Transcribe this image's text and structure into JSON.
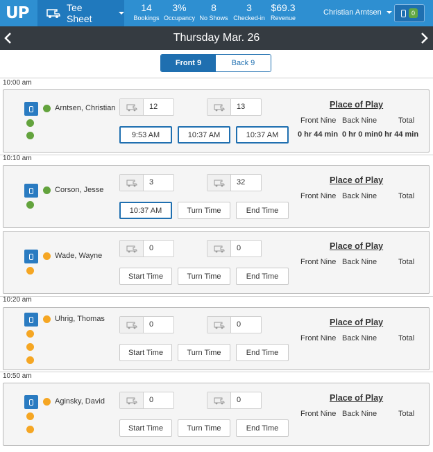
{
  "header": {
    "logo": "UP",
    "app_title": "Tee Sheet",
    "stats": [
      {
        "value": "14",
        "label": "Bookings"
      },
      {
        "value": "3%",
        "label": "Occupancy"
      },
      {
        "value": "8",
        "label": "No Shows"
      },
      {
        "value": "3",
        "label": "Checked-in"
      },
      {
        "value": "$69.3",
        "label": "Revenue"
      }
    ],
    "user_name": "Christian Arntsen",
    "message_count": "0",
    "icons": {
      "cart": "golf-cart-icon",
      "caret": "caret-down-icon",
      "phone": "mobile-phone-icon"
    }
  },
  "datebar": {
    "date": "Thursday Mar. 26",
    "prev_icon": "chevron-left-icon",
    "next_icon": "chevron-right-icon"
  },
  "nine_toggle": {
    "front": "Front 9",
    "back": "Back 9",
    "selected": "front"
  },
  "place_of_play": {
    "title": "Place of Play",
    "front_label": "Front Nine",
    "back_label": "Back Nine",
    "total_label": "Total"
  },
  "time_slots": [
    {
      "time": "10:00 am"
    },
    {
      "time": "10:10 am"
    },
    {
      "time": "10:20 am"
    },
    {
      "time": "10:50 am"
    }
  ],
  "bookings": [
    {
      "player": "Arntsen, Christian",
      "status_color": "#63a33d",
      "extra_dots": 2,
      "cart1": "12",
      "cart2": "13",
      "start": "9:53 AM",
      "turn": "10:37 AM",
      "end": "10:37 AM",
      "start_set": true,
      "turn_set": true,
      "end_set": true,
      "front_duration": "0 hr 44 min",
      "back_duration": "0 hr 0 min",
      "total_duration": "0 hr 44 min"
    },
    {
      "player": "Corson, Jesse",
      "status_color": "#63a33d",
      "extra_dots": 1,
      "cart1": "3",
      "cart2": "32",
      "start": "10:37 AM",
      "turn": "Turn Time",
      "end": "End Time",
      "start_set": true,
      "turn_set": false,
      "end_set": false
    },
    {
      "player": "Wade, Wayne",
      "status_color": "#f5a623",
      "extra_dots": 1,
      "cart1": "0",
      "cart2": "0",
      "start": "Start Time",
      "turn": "Turn Time",
      "end": "End Time",
      "start_set": false,
      "turn_set": false,
      "end_set": false
    },
    {
      "player": "Uhrig, Thomas",
      "status_color": "#f5a623",
      "extra_dots": 3,
      "cart1": "0",
      "cart2": "0",
      "start": "Start Time",
      "turn": "Turn Time",
      "end": "End Time",
      "start_set": false,
      "turn_set": false,
      "end_set": false
    },
    {
      "player": "Aginsky, David",
      "status_color": "#f5a623",
      "extra_dots": 2,
      "cart1": "0",
      "cart2": "0",
      "start": "Start Time",
      "turn": "Turn Time",
      "end": "End Time",
      "start_set": false,
      "turn_set": false,
      "end_set": false
    }
  ],
  "colors": {
    "header_blue": "#2e8fd1",
    "header_dark_blue": "#2079bd",
    "date_bar": "#353b41",
    "accent": "#1f6fb0",
    "checked_in": "#63a33d",
    "not_checked_in": "#f5a623"
  }
}
